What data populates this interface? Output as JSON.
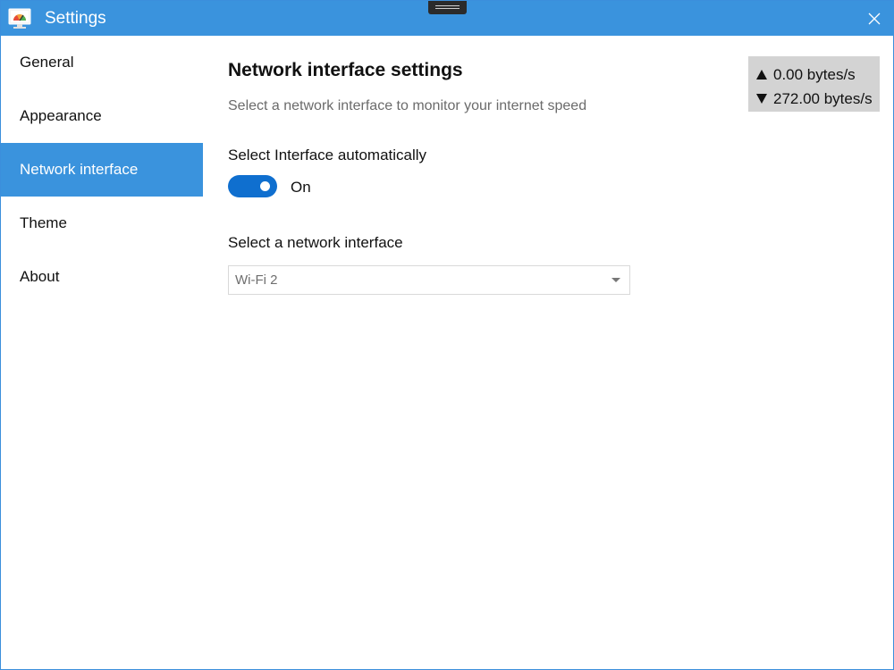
{
  "window": {
    "title": "Settings",
    "accent": "#3a93dd",
    "app_icon": "network-monitor-icon",
    "close_icon": "close-icon"
  },
  "sidebar": {
    "items": [
      {
        "label": "General",
        "active": false
      },
      {
        "label": "Appearance",
        "active": false
      },
      {
        "label": "Network interface",
        "active": true
      },
      {
        "label": "Theme",
        "active": false
      },
      {
        "label": "About",
        "active": false
      }
    ]
  },
  "main": {
    "title": "Network interface settings",
    "subtitle": "Select a network interface to monitor your internet speed",
    "auto_select": {
      "label": "Select Interface automatically",
      "state_label": "On",
      "enabled": true,
      "toggle_color": "#0f6fcf"
    },
    "interface_select": {
      "label": "Select a network interface",
      "value": "Wi-Fi 2"
    }
  },
  "speed": {
    "upload": "0.00 bytes/s",
    "download": "272.00 bytes/s",
    "upload_icon": "upload-arrow-icon",
    "download_icon": "download-arrow-icon"
  }
}
